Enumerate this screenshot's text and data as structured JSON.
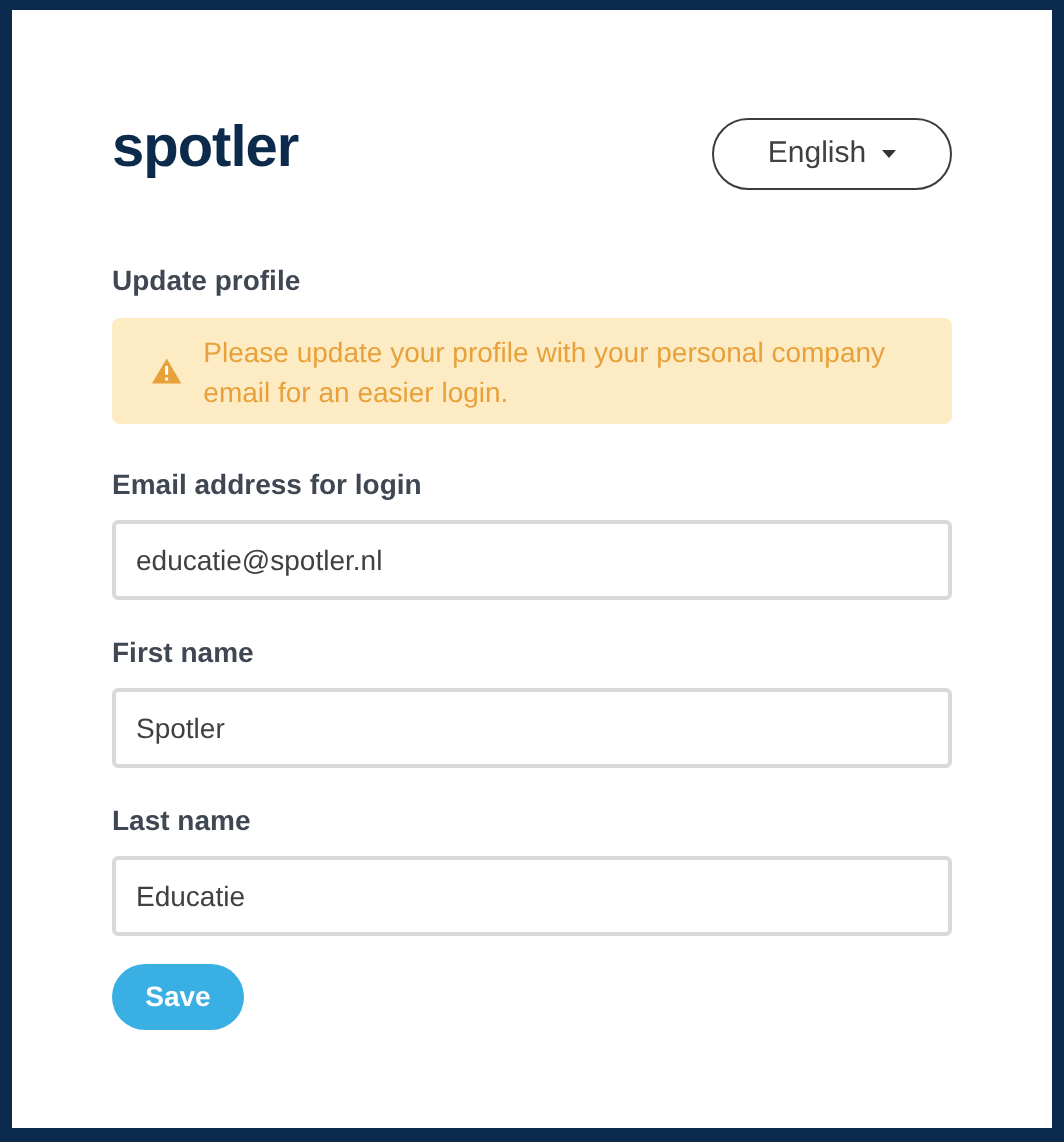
{
  "logo": "spotler",
  "language": {
    "label": "English"
  },
  "title": "Update profile",
  "alert": {
    "kind": "warning",
    "text": "Please update your profile with your personal company email for an easier login."
  },
  "fields": [
    {
      "label": "Email address for login",
      "value": "educatie@spotler.nl"
    },
    {
      "label": "First name",
      "value": "Spotler"
    },
    {
      "label": "Last name",
      "value": "Educatie"
    }
  ],
  "save": "Save"
}
